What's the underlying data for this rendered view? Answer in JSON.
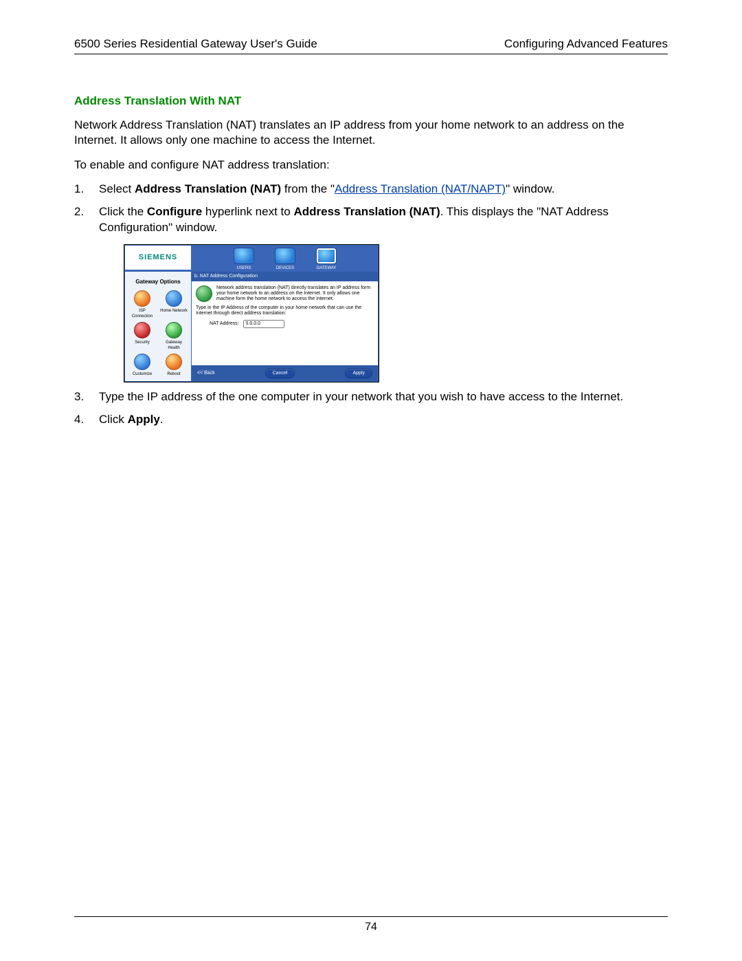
{
  "header": {
    "left": "6500 Series Residential Gateway User's Guide",
    "right": "Configuring Advanced Features"
  },
  "section_title": "Address Translation With NAT",
  "para1": "Network Address Translation (NAT) translates an IP address from your home network to an address on the Internet. It allows only one machine to access the Internet.",
  "para2": "To enable and configure NAT address translation:",
  "steps": {
    "s1": {
      "lead": "Select ",
      "bold": "Address Translation (NAT)",
      "mid": " from the \"",
      "link": "Address Translation (NAT/NAPT)",
      "tail": "\" window."
    },
    "s2": {
      "lead": "Click the ",
      "bold1": "Configure",
      "mid1": " hyperlink next to ",
      "bold2": "Address Translation (NAT)",
      "tail": ". This displays the \"NAT Address Configuration\" window."
    },
    "s3": "Type the IP address of the one computer in your network that you wish to have access to the Internet.",
    "s4": {
      "lead": "Click ",
      "bold": "Apply",
      "tail": "."
    }
  },
  "screenshot": {
    "brand": "SIEMENS",
    "tabs": {
      "users": "USERS",
      "devices": "DEVICES",
      "gateway": "GATEWAY"
    },
    "sidebar": {
      "title": "Gateway Options",
      "items": {
        "isp": "ISP Connection",
        "home": "Home Network",
        "security": "Security",
        "health": "Gateway Health",
        "customize": "Customize",
        "reboot": "Reboot"
      }
    },
    "panel": {
      "path": "b. NAT Address Configuration",
      "explain": "Network address translation (NAT) directly translates an IP address form your home network to an address on the Internet. It only allows one machine form the home network to access the Internet.",
      "prompt": "Type in the IP Address of the computer in your home network that can use the Internet through direct address translation:",
      "field_label": "NAT Address:",
      "field_value": "0.0.0.0",
      "buttons": {
        "back": "<< Back",
        "cancel": "Cancel",
        "apply": "Apply"
      }
    }
  },
  "page_number": "74"
}
